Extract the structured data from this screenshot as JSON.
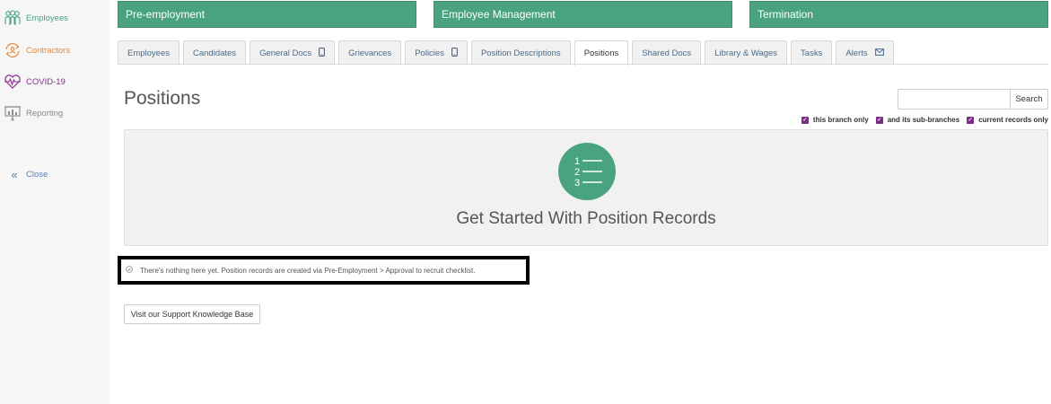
{
  "sidebar": {
    "items": [
      {
        "label": "Employees",
        "icon": "employees-icon",
        "color": "#4aa37f"
      },
      {
        "label": "Contractors",
        "icon": "contractors-icon",
        "color": "#e58a3a"
      },
      {
        "label": "COVID-19",
        "icon": "heartbeat-icon",
        "color": "#8a2f8a"
      },
      {
        "label": "Reporting",
        "icon": "report-icon",
        "color": "#8a8a8a"
      }
    ],
    "close_label": "Close",
    "close_icon": "double-chevron-left-icon"
  },
  "sections": [
    "Pre-employment",
    "Employee Management",
    "Termination"
  ],
  "tabs": [
    {
      "label": "Employees"
    },
    {
      "label": "Candidates"
    },
    {
      "label": "General Docs",
      "icon": "mobile-icon"
    },
    {
      "label": "Grievances"
    },
    {
      "label": "Policies",
      "icon": "mobile-icon"
    },
    {
      "label": "Position Descriptions"
    },
    {
      "label": "Positions",
      "active": true
    },
    {
      "label": "Shared Docs"
    },
    {
      "label": "Library & Wages"
    },
    {
      "label": "Tasks"
    },
    {
      "label": "Alerts",
      "icon": "envelope-icon"
    }
  ],
  "page": {
    "title": "Positions"
  },
  "search": {
    "placeholder": "",
    "button_label": "Search"
  },
  "filters": [
    {
      "label": "this branch only",
      "checked": true
    },
    {
      "label": "and its sub-branches",
      "checked": true
    },
    {
      "label": "current records only",
      "checked": true
    }
  ],
  "empty_state": {
    "icon": "numbered-list-icon",
    "numbers": [
      "1",
      "2",
      "3"
    ],
    "title": "Get Started With Position Records"
  },
  "notice": {
    "icon": "check-circle-icon",
    "text": "There's nothing here yet. Position records are created via Pre-Employment > Approval to recruit checklist."
  },
  "support_button": {
    "label": "Visit our Support Knowledge Base"
  },
  "colors": {
    "primary": "#4aa37f",
    "accent": "#7b2c85",
    "contractors": "#e58a3a",
    "covid": "#8a2f8a"
  }
}
